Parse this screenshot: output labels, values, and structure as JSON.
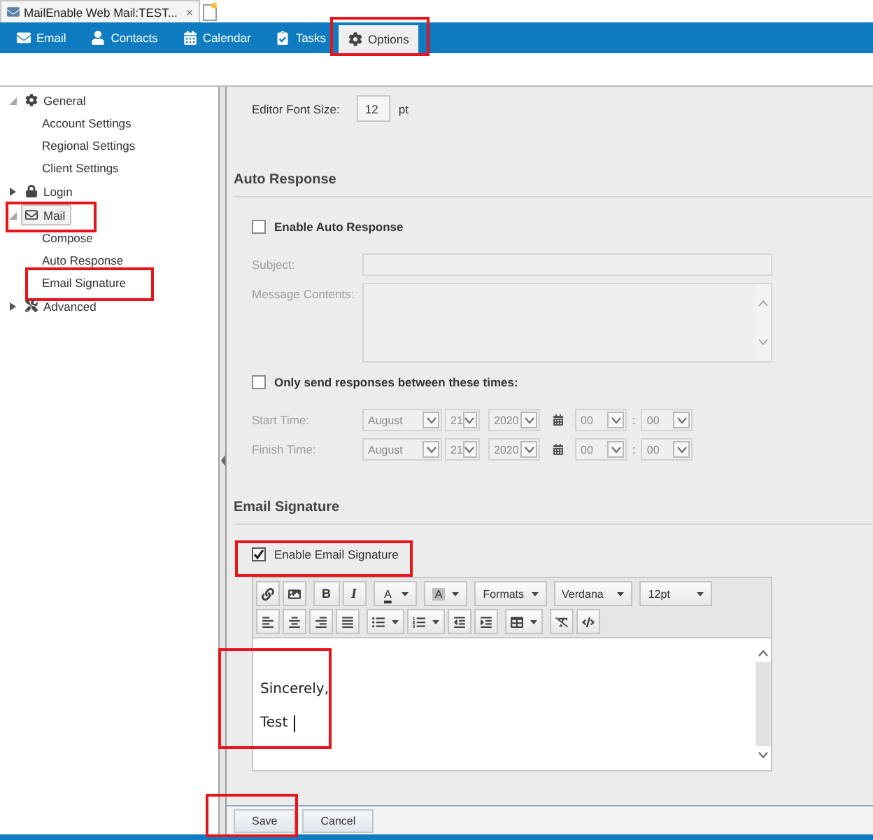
{
  "browser_tab": {
    "title": "MailEnable Web Mail:TEST...",
    "close": "×"
  },
  "nav_tabs": [
    {
      "label": "Email",
      "selected": false,
      "highlighted": false
    },
    {
      "label": "Contacts",
      "selected": false,
      "highlighted": false
    },
    {
      "label": "Calendar",
      "selected": false,
      "highlighted": false
    },
    {
      "label": "Tasks",
      "selected": false,
      "highlighted": false
    },
    {
      "label": "Options",
      "selected": true,
      "highlighted": true
    }
  ],
  "sidebar": {
    "items": [
      {
        "label": "General",
        "expanded": true,
        "selected": false,
        "highlighted": false,
        "children": [
          {
            "label": "Account Settings",
            "selected": false,
            "highlighted": false
          },
          {
            "label": "Regional Settings",
            "selected": false,
            "highlighted": false
          },
          {
            "label": "Client Settings",
            "selected": false,
            "highlighted": false
          }
        ]
      },
      {
        "label": "Login",
        "expanded": false,
        "selected": false,
        "highlighted": false
      },
      {
        "label": "Mail",
        "expanded": true,
        "selected": true,
        "highlighted": true,
        "children": [
          {
            "label": "Compose",
            "selected": false,
            "highlighted": false
          },
          {
            "label": "Auto Response",
            "selected": false,
            "highlighted": false
          },
          {
            "label": "Email Signature",
            "selected": false,
            "highlighted": true
          }
        ]
      },
      {
        "label": "Advanced",
        "expanded": false,
        "selected": false,
        "highlighted": false
      }
    ]
  },
  "editor_font_size": {
    "label": "Editor Font Size:",
    "value": "12",
    "unit": "pt"
  },
  "auto_response": {
    "heading": "Auto Response",
    "enable": {
      "label": "Enable Auto Response",
      "checked": false
    },
    "subject": {
      "label": "Subject:",
      "disabled": true
    },
    "message": {
      "label": "Message Contents:",
      "disabled": true
    },
    "time_limit": {
      "label": "Only send responses between these times:",
      "checked": false
    },
    "times": [
      {
        "label": "Start Time:",
        "disabled": true,
        "month": "August",
        "day": "21",
        "year": "2020",
        "hour": "00",
        "separator": ":",
        "minute": "00"
      },
      {
        "label": "Finish Time:",
        "disabled": true,
        "month": "August",
        "day": "21",
        "year": "2020",
        "hour": "00",
        "separator": ":",
        "minute": "00"
      }
    ]
  },
  "email_signature": {
    "heading": "Email Signature",
    "enable": {
      "label": "Enable Email Signature",
      "checked": true,
      "highlighted": true
    },
    "toolbar": {
      "rows": [
        {
          "groups": [
            {
              "buttons": [
                {
                  "kind": "link",
                  "menu": false
                },
                {
                  "kind": "image",
                  "menu": false
                }
              ]
            },
            {
              "buttons": [
                {
                  "kind": "bold",
                  "label": "B",
                  "menu": false
                },
                {
                  "kind": "italic",
                  "label": "I",
                  "menu": false
                }
              ]
            },
            {
              "buttons": [
                {
                  "kind": "text-color",
                  "label": "A",
                  "menu": true
                }
              ]
            },
            {
              "buttons": [
                {
                  "kind": "background-color",
                  "label": "A",
                  "menu": true
                }
              ]
            },
            {
              "buttons": [
                {
                  "kind": "menu",
                  "label": "Formats",
                  "menu": true
                }
              ]
            },
            {
              "buttons": [
                {
                  "kind": "listbox",
                  "label": "Verdana",
                  "menu": true
                }
              ]
            },
            {
              "buttons": [
                {
                  "kind": "listbox",
                  "label": "12pt",
                  "menu": true
                }
              ]
            }
          ]
        },
        {
          "groups": [
            {
              "buttons": [
                {
                  "kind": "align-left",
                  "menu": false
                },
                {
                  "kind": "align-center",
                  "menu": false
                },
                {
                  "kind": "align-right",
                  "menu": false
                },
                {
                  "kind": "justify",
                  "menu": false
                }
              ]
            },
            {
              "buttons": [
                {
                  "kind": "bullet-list",
                  "menu": true
                },
                {
                  "kind": "numbered-list",
                  "menu": true
                },
                {
                  "kind": "outdent",
                  "menu": false
                },
                {
                  "kind": "indent",
                  "menu": false
                }
              ]
            },
            {
              "buttons": [
                {
                  "kind": "table",
                  "menu": true
                }
              ]
            },
            {
              "buttons": [
                {
                  "kind": "clear-format",
                  "menu": false
                },
                {
                  "kind": "code",
                  "menu": false
                }
              ]
            }
          ]
        }
      ]
    },
    "content": {
      "lines": [
        "Sincerely,",
        "Test"
      ],
      "caret": true,
      "highlighted": true
    }
  },
  "footer": {
    "buttons": [
      {
        "label": "Save",
        "highlighted": true
      },
      {
        "label": "Cancel",
        "highlighted": false
      }
    ]
  }
}
